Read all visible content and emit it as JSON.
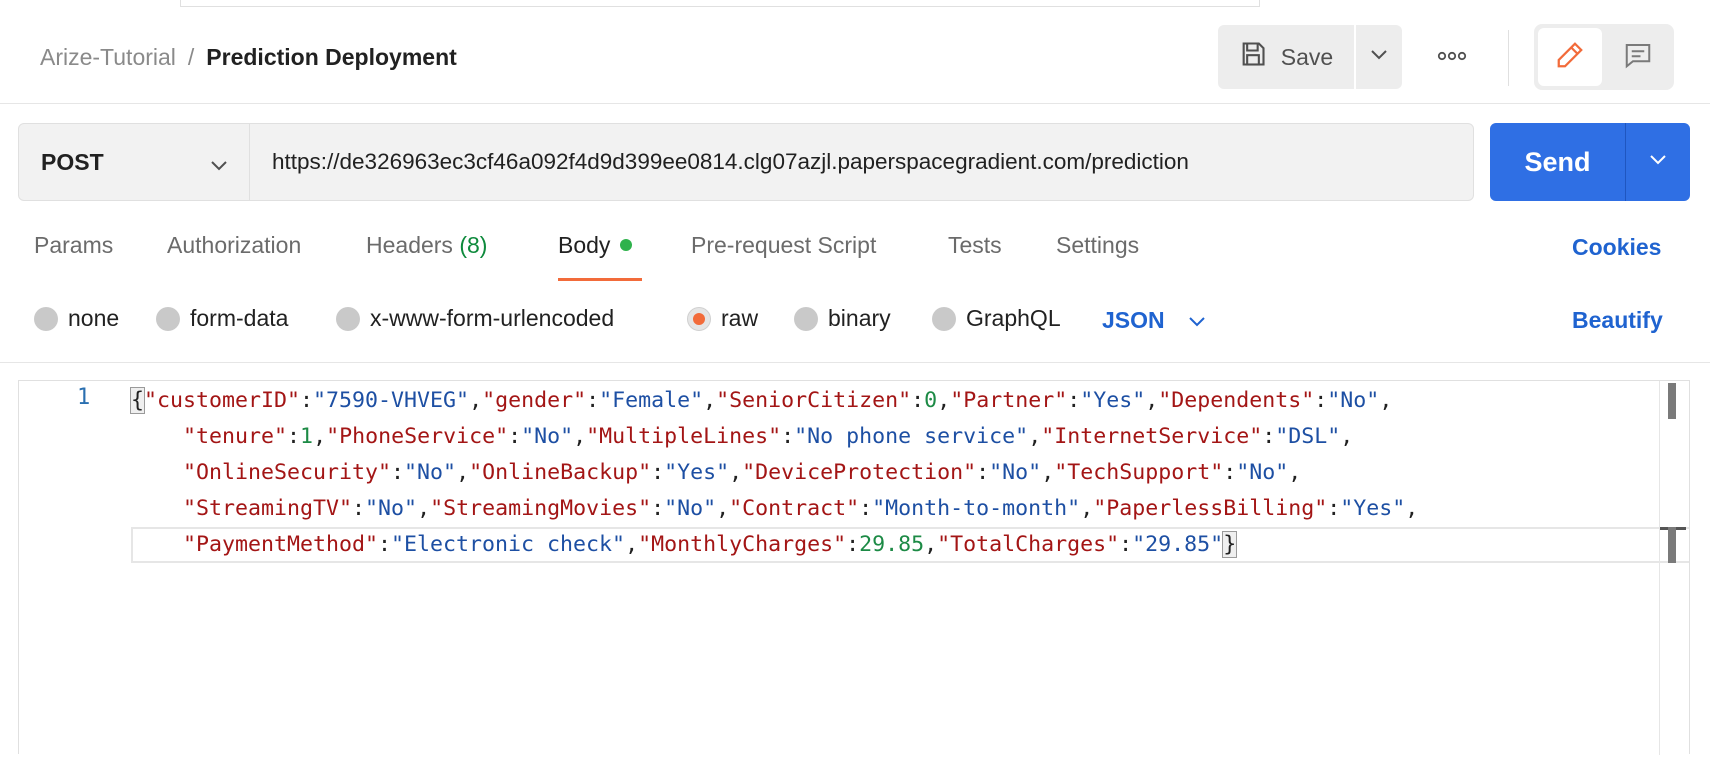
{
  "breadcrumb": {
    "parent": "Arize-Tutorial",
    "separator": "/",
    "current": "Prediction Deployment"
  },
  "toolbar": {
    "save_label": "Save"
  },
  "request": {
    "method": "POST",
    "url": "https://de326963ec3cf46a092f4d9d399ee0814.clg07azjl.paperspacegradient.com/prediction",
    "send_label": "Send"
  },
  "tabs": {
    "params": "Params",
    "authorization": "Authorization",
    "headers": "Headers",
    "headers_count": "(8)",
    "body": "Body",
    "prerequest": "Pre-request Script",
    "tests": "Tests",
    "settings": "Settings",
    "cookies": "Cookies"
  },
  "body_types": {
    "none": "none",
    "form_data": "form-data",
    "urlencoded": "x-www-form-urlencoded",
    "raw": "raw",
    "binary": "binary",
    "graphql": "GraphQL",
    "selected": "raw",
    "format": "JSON",
    "beautify": "Beautify"
  },
  "editor": {
    "line_number": "1",
    "lines": [
      "{\"customerID\":\"7590-VHVEG\",\"gender\":\"Female\",\"SeniorCitizen\":0,\"Partner\":\"Yes\",\"Dependents\":\"No\",",
      "    \"tenure\":1,\"PhoneService\":\"No\",\"MultipleLines\":\"No phone service\",\"InternetService\":\"DSL\",",
      "    \"OnlineSecurity\":\"No\",\"OnlineBackup\":\"Yes\",\"DeviceProtection\":\"No\",\"TechSupport\":\"No\",",
      "    \"StreamingTV\":\"No\",\"StreamingMovies\":\"No\",\"Contract\":\"Month-to-month\",\"PaperlessBilling\":\"Yes\",",
      "    \"PaymentMethod\":\"Electronic check\",\"MonthlyCharges\":29.85,\"TotalCharges\":\"29.85\"}"
    ]
  },
  "colors": {
    "accent": "#f26b3a",
    "send": "#2f6fe4",
    "link": "#1f63d0",
    "dot": "#2fb24c"
  }
}
